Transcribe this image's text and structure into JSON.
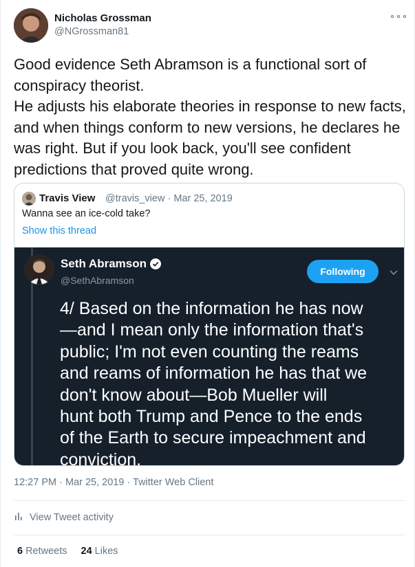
{
  "author": {
    "display_name": "Nicholas Grossman",
    "handle": "@NGrossman81",
    "avatar_icon": "user-avatar"
  },
  "more_icon": "more-horizontal-icon",
  "tweet_text": [
    "Good evidence Seth Abramson is a functional sort of conspiracy theorist.",
    "He adjusts his elaborate theories in response to new facts, and when things conform to new versions, he declares he was right. But if you look back, you'll see confident predictions that proved quite wrong."
  ],
  "quoted": {
    "display_name": "Travis View",
    "meta": "@travis_view · Mar 25, 2019",
    "text": "Wanna see an ice-cold take?",
    "show_thread": "Show this thread",
    "image": {
      "name": "Seth Abramson",
      "handle": "@SethAbramson",
      "follow_label": "Following",
      "text_lines": [
        "4/ Based on the information he has now",
        "—and I mean only the information that's",
        "public; I'm not even counting the reams",
        "and reams of information he has that we",
        "don't know about—Bob Mueller will",
        "hunt both Trump and Pence to the ends",
        "of the Earth to secure impeachment and",
        "conviction."
      ]
    }
  },
  "timestamp": "12:27 PM · Mar 25, 2019 · Twitter Web Client",
  "activity_label": "View Tweet activity",
  "stats": {
    "retweets_count": "6",
    "retweets_label": "Retweets",
    "likes_count": "24",
    "likes_label": "Likes"
  },
  "colors": {
    "link": "#1b95e0",
    "secondary_text": "#657786",
    "dark_bg": "#15202b",
    "follow_blue": "#1da1f2"
  }
}
